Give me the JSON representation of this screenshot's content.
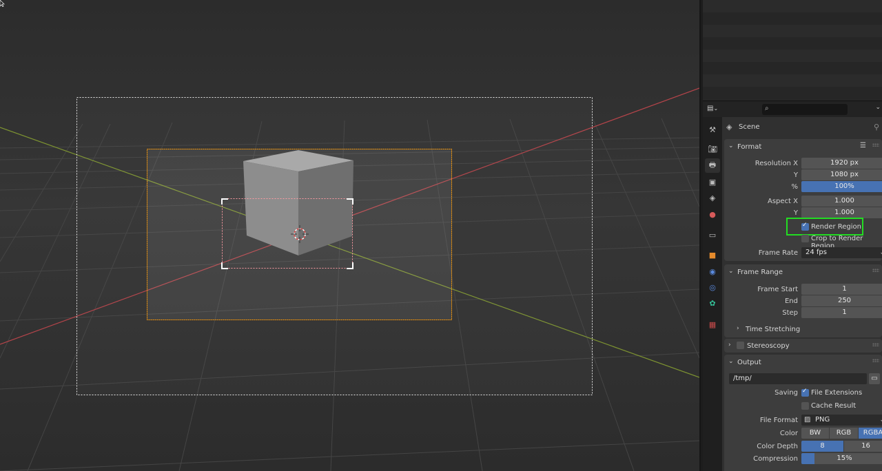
{
  "viewport": {
    "background": "#3a3a3a",
    "x_axis_color": "#b4444a",
    "y_axis_color": "#7e9431",
    "camera_frame_color": "#ff9900",
    "render_region_color": "#ff9aa2"
  },
  "properties": {
    "context": "Scene",
    "format": {
      "title": "Format",
      "resolution_x_label": "Resolution X",
      "resolution_x": "1920 px",
      "resolution_y_label": "Y",
      "resolution_y": "1080 px",
      "percent_label": "%",
      "percent": "100%",
      "aspect_x_label": "Aspect X",
      "aspect_x": "1.000",
      "aspect_y_label": "Y",
      "aspect_y": "1.000",
      "render_region_label": "Render Region",
      "crop_label": "Crop to Render Region",
      "frame_rate_label": "Frame Rate",
      "frame_rate": "24 fps"
    },
    "frame_range": {
      "title": "Frame Range",
      "start_label": "Frame Start",
      "start": "1",
      "end_label": "End",
      "end": "250",
      "step_label": "Step",
      "step": "1",
      "time_stretching": "Time Stretching"
    },
    "stereoscopy": {
      "title": "Stereoscopy"
    },
    "output": {
      "title": "Output",
      "path": "/tmp/",
      "saving_label": "Saving",
      "file_extensions_label": "File Extensions",
      "cache_result_label": "Cache Result",
      "file_format_label": "File Format",
      "file_format": "PNG",
      "color_label": "Color",
      "color_options": [
        "BW",
        "RGB",
        "RGBA"
      ],
      "color_depth_label": "Color Depth",
      "color_depth_options": [
        "8",
        "16"
      ],
      "compression_label": "Compression",
      "compression": "15%"
    }
  }
}
